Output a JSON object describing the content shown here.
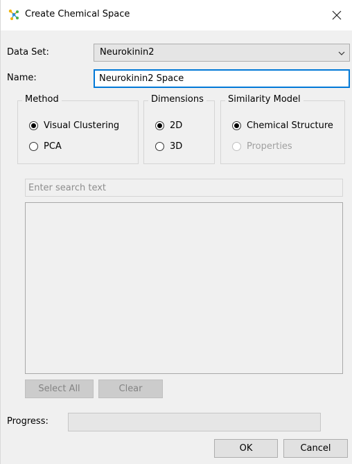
{
  "window": {
    "title": "Create Chemical Space"
  },
  "form": {
    "dataset_label": "Data Set:",
    "dataset_value": "Neurokinin2",
    "name_label": "Name:",
    "name_value": "Neurokinin2 Space"
  },
  "method": {
    "title": "Method",
    "options": [
      {
        "label": "Visual Clustering",
        "checked": true
      },
      {
        "label": "PCA",
        "checked": false
      }
    ]
  },
  "dimensions": {
    "title": "Dimensions",
    "options": [
      {
        "label": "2D",
        "checked": true
      },
      {
        "label": "3D",
        "checked": false
      }
    ]
  },
  "similarity": {
    "title": "Similarity Model",
    "options": [
      {
        "label": "Chemical Structure",
        "checked": true,
        "enabled": true
      },
      {
        "label": "Properties",
        "checked": false,
        "enabled": false
      }
    ]
  },
  "search": {
    "placeholder": "Enter search text"
  },
  "list_buttons": {
    "select_all": "Select All",
    "clear": "Clear"
  },
  "progress": {
    "label": "Progress:",
    "value": 0
  },
  "footer": {
    "ok": "OK",
    "cancel": "Cancel"
  },
  "colors": {
    "accent": "#0078d7",
    "progress": "#06b025"
  }
}
